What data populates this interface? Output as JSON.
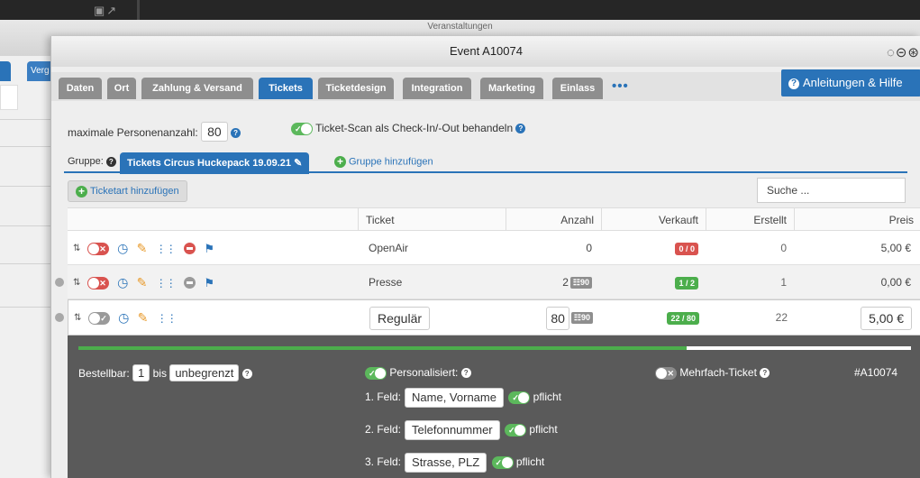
{
  "bg": {
    "title": "Veranstaltungen",
    "tab_label": "Verg"
  },
  "modal": {
    "title": "Event A10074",
    "window_buttons": "◌⊝⊛",
    "tabs": [
      {
        "label": "Daten",
        "active": false
      },
      {
        "label": "Ort",
        "active": false
      },
      {
        "label": "Zahlung & Versand",
        "active": false
      },
      {
        "label": "Tickets",
        "active": true
      },
      {
        "label": "Ticketdesign",
        "active": false
      },
      {
        "label": "Integration",
        "active": false
      },
      {
        "label": "Marketing",
        "active": false
      },
      {
        "label": "Einlass",
        "active": false
      }
    ],
    "more": "•••",
    "help_label": "Anleitungen & Hilfe"
  },
  "settings": {
    "max_label": "maximale Personenanzahl:",
    "max_value": "80",
    "scan_label": "Ticket-Scan als Check-In/-Out behandeln"
  },
  "group": {
    "label": "Gruppe:",
    "tab": "Tickets Circus Huckepack 19.09.21",
    "add": "Gruppe hinzufügen"
  },
  "toolbar": {
    "add_type": "Ticketart hinzufügen",
    "search_placeholder": "Suche ..."
  },
  "table": {
    "headers": {
      "ticket": "Ticket",
      "anzahl": "Anzahl",
      "verkauft": "Verkauft",
      "erstellt": "Erstellt",
      "preis": "Preis"
    },
    "rows": [
      {
        "ticket": "OpenAir",
        "anzahl": "0",
        "ticketbadge": "",
        "verkauft": "0 / 0",
        "erstellt": "0",
        "preis": "5,00 €"
      },
      {
        "ticket": "Presse",
        "anzahl": "2",
        "ticketbadge": "90",
        "verkauft": "1 / 2",
        "erstellt": "1",
        "preis": "0,00 €"
      },
      {
        "ticket": "Regulär",
        "anzahl": "80",
        "ticketbadge": "90",
        "verkauft": "22 / 80",
        "erstellt": "22",
        "preis": "5,00 €"
      }
    ]
  },
  "detail": {
    "progress": 0.73,
    "bestellbar_label": "Bestellbar:",
    "bestellbar_from": "1",
    "bis": "bis",
    "bestellbar_to": "unbegrenzt",
    "personalisiert": "Personalisiert:",
    "mehrfach": "Mehrfach-Ticket",
    "event_id": "#A10074",
    "fields": [
      {
        "label": "1. Feld:",
        "value": "Name, Vorname",
        "req": "pflicht"
      },
      {
        "label": "2. Feld:",
        "value": "Telefonnummer",
        "req": "pflicht"
      },
      {
        "label": "3. Feld:",
        "value": "Strasse, PLZ",
        "req": "pflicht"
      }
    ]
  },
  "colors": {
    "accent": "#2a73b8",
    "success": "#4cae4c",
    "danger": "#d9534f"
  }
}
